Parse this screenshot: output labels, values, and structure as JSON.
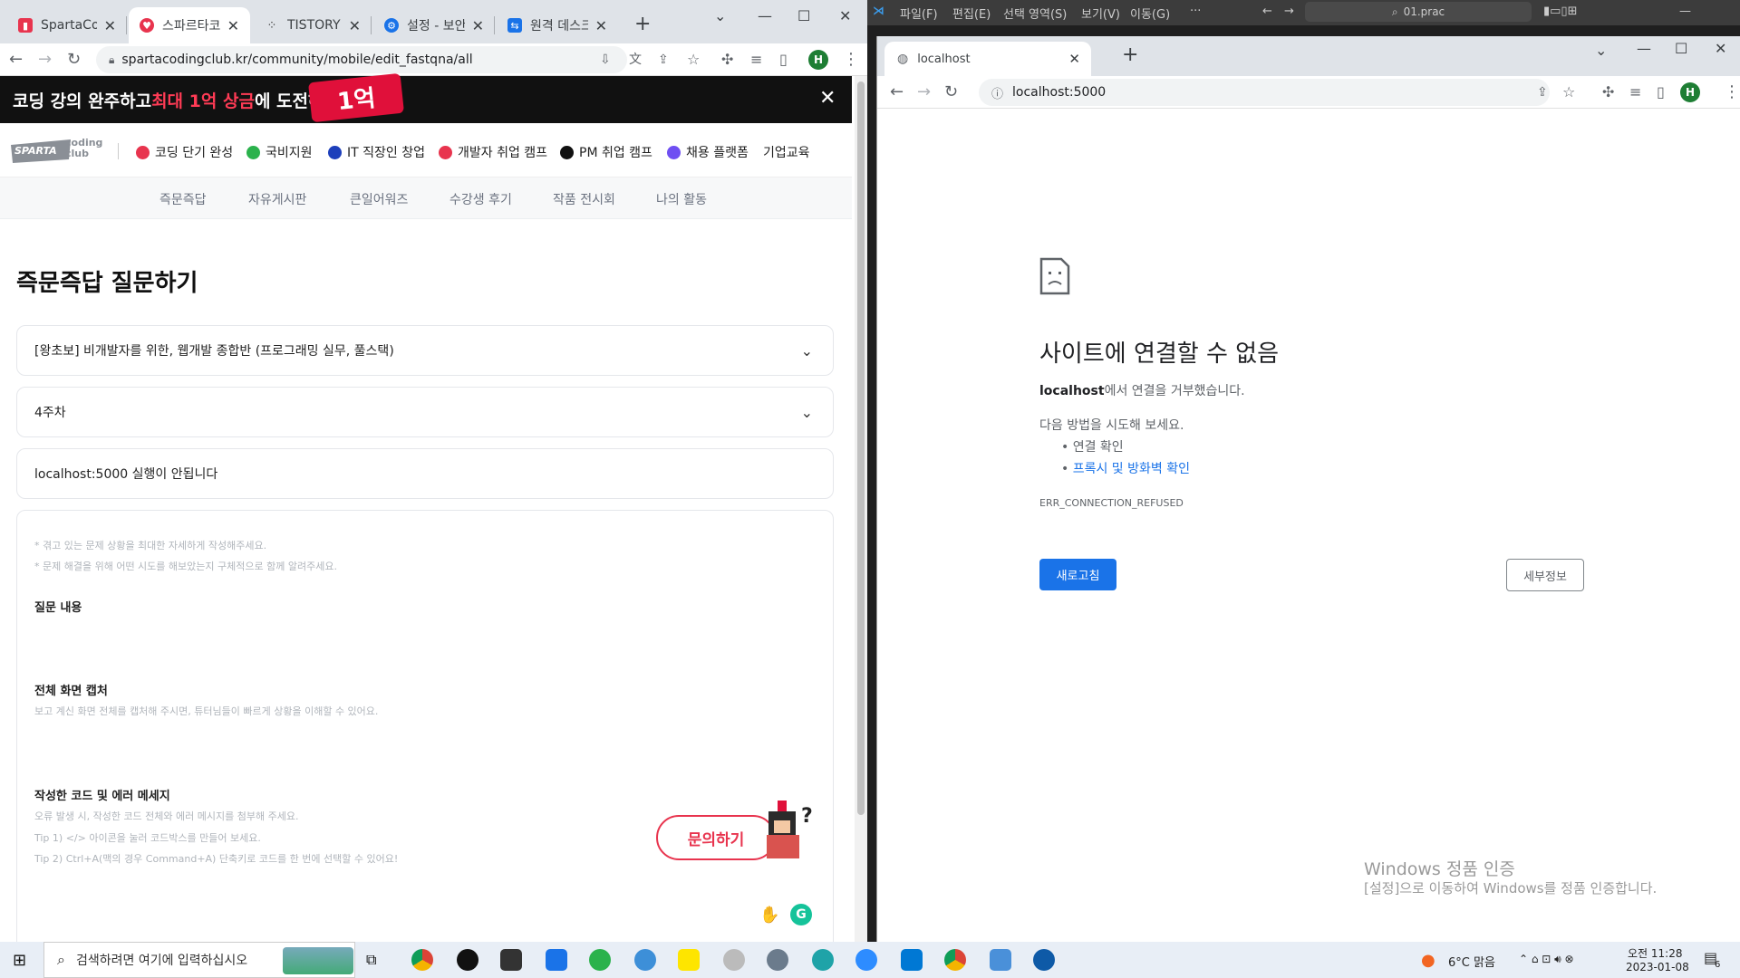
{
  "left_browser": {
    "tabs": [
      {
        "label": "SpartaCoding",
        "color": "#e8344e"
      },
      {
        "label": "스파르타코딩",
        "color": "#e8344e"
      },
      {
        "label": "TISTORY",
        "color": "#333333"
      },
      {
        "label": "설정 - 보안",
        "color": "#1a73e8"
      },
      {
        "label": "원격 데스크",
        "color": "#1a73e8"
      }
    ],
    "url": "spartacodingclub.kr/community/mobile/edit_fastqna/all",
    "profile_initial": "H"
  },
  "banner": {
    "text_pre": "코딩 강의 완주하고 ",
    "text_red": "최대 1억 상금",
    "text_post": "에 도전하기 >",
    "badge": "1억",
    "close": "✕"
  },
  "site_nav": {
    "logo_main": "SPARTA",
    "logo_sub": "coding club",
    "items": [
      {
        "label": "코딩 단기 완성",
        "color": "#e8344e"
      },
      {
        "label": "국비지원",
        "color": "#2bb24c"
      },
      {
        "label": "IT 직장인 창업",
        "color": "#1d3fbb"
      },
      {
        "label": "개발자 취업 캠프",
        "color": "#e8344e"
      },
      {
        "label": "PM 취업 캠프",
        "color": "#111111"
      },
      {
        "label": "채용 플랫폼",
        "color": "#6f4ff2"
      },
      {
        "label": "기업교육",
        "color": ""
      }
    ],
    "sub_items": [
      "즉문즉답",
      "자유게시판",
      "큰일어워즈",
      "수강생 후기",
      "작품 전시회",
      "나의 활동"
    ]
  },
  "form": {
    "title": "즉문즉답 질문하기",
    "course": "[왕초보] 비개발자를 위한, 웹개발 종합반 (프로그래밍 실무, 풀스택)",
    "week": "4주차",
    "question_title": "localhost:5000 실행이 안됩니다",
    "hint1": "* 겪고 있는 문제 상황을 최대한 자세하게 작성해주세요.",
    "hint2": "* 문제 해결을 위해 어떤 시도를 해보았는지 구체적으로 함께 알려주세요.",
    "section1": "질문 내용",
    "section2": "전체 화면 캡처",
    "section2_hint": "보고 계신 화면 전체를 캡처해 주시면, 튜터님들이 빠르게 상황을 이해할 수 있어요.",
    "section3": "작성한 코드 및 에러 메세지",
    "section3_hint1": "오류 발생 시, 작성한 코드 전체와 에러 메시지를 첨부해 주세요.",
    "section3_hint2": "Tip 1) </> 아이콘을 눌러 코드박스를 만들어 보세요.",
    "section3_hint3": "Tip 2) Ctrl+A(맥의 경우 Command+A) 단축키로 코드를 한 번에 선택할 수 있어요!",
    "ask_button": "문의하기"
  },
  "vscode": {
    "menus": [
      "파일(F)",
      "편집(E)",
      "선택 영역(S)",
      "보기(V)",
      "이동(G)",
      "···"
    ],
    "search": "01.prac"
  },
  "right_browser": {
    "tab_label": "localhost",
    "url": "localhost:5000",
    "profile_initial": "H"
  },
  "error_page": {
    "title": "사이트에 연결할 수 없음",
    "host": "localhost",
    "refused": "에서 연결을 거부했습니다.",
    "try_text": "다음 방법을 시도해 보세요.",
    "suggestion1": "연결 확인",
    "suggestion2": "프록시 및 방화벽 확인",
    "code": "ERR_CONNECTION_REFUSED",
    "reload": "새로고침",
    "details": "세부정보"
  },
  "watermark": {
    "line1": "Windows 정품 인증",
    "line2": "[설정]으로 이동하여 Windows를 정품 인증합니다."
  },
  "taskbar": {
    "search_placeholder": "검색하려면 여기에 입력하십시오",
    "weather": "6°C  맑음",
    "time": "오전 11:28",
    "date": "2023-01-08",
    "notif_count": "6"
  }
}
